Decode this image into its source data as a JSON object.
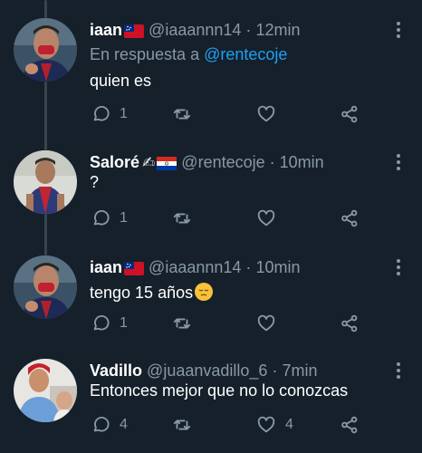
{
  "tweets": [
    {
      "name": "iaan",
      "flag": "flag-samoa",
      "handle": "@iaaannn14",
      "sep": "·",
      "time": "12min",
      "reply_prefix": "En respuesta a",
      "reply_mention": "@rentecoje",
      "text": "quien es",
      "reply_count": "1",
      "retweet_count": "",
      "like_count": ""
    },
    {
      "name": "Saloré",
      "decor": "writing-hand-emoji",
      "flag": "flag-paraguay",
      "handle": "@rentecoje",
      "sep": "·",
      "time": "10min",
      "text": "?",
      "reply_count": "1",
      "retweet_count": "",
      "like_count": ""
    },
    {
      "name": "iaan",
      "flag": "flag-samoa",
      "handle": "@iaaannn14",
      "sep": "·",
      "time": "10min",
      "text": "tengo 15 años",
      "text_emoji": "pensive-face-emoji",
      "reply_count": "1",
      "retweet_count": "",
      "like_count": ""
    },
    {
      "name": "Vadillo",
      "handle": "@juaanvadillo_6",
      "sep": "·",
      "time": "7min",
      "text": "Entonces mejor que no lo conozcas",
      "reply_count": "4",
      "retweet_count": "",
      "like_count": "4"
    }
  ],
  "colors": {
    "background": "#15202b",
    "secondary_text": "#8899a6",
    "mention": "#1da1f2",
    "thread_line": "#38444d"
  }
}
